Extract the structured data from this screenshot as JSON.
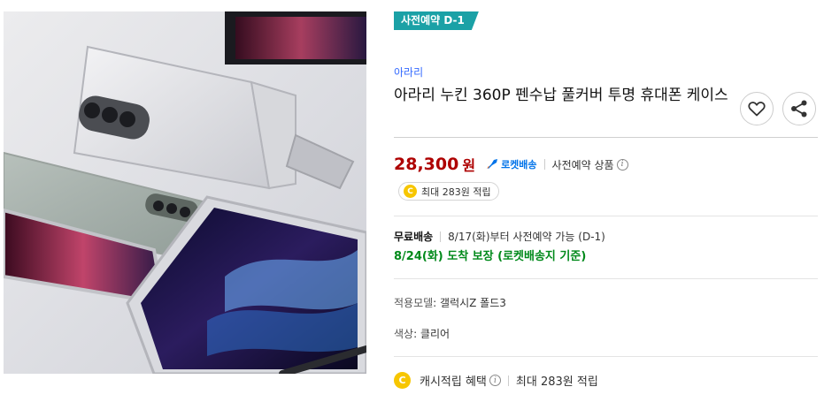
{
  "product": {
    "badge": "사전예약 D-1",
    "brand": "아라리",
    "title": "아라리 누킨 360P 펜수납 풀커버 투명 휴대폰 케이스",
    "price": "28,300",
    "price_unit": "원",
    "rocket_label": "로켓배송",
    "preorder_label": "사전예약 상품",
    "reward_text": "최대 283원 적립",
    "coin_letter": "C"
  },
  "shipping": {
    "label": "무료배송",
    "schedule": "8/17(화)부터 사전예약 가능 (D-1)",
    "arrival": "8/24(화) 도착 보장 (로켓배송지 기준)"
  },
  "specs": [
    {
      "label": "적용모델",
      "value": "갤럭시Z 폴드3"
    },
    {
      "label": "색상",
      "value": "클리어"
    }
  ],
  "cashback": {
    "label": "캐시적립 혜택",
    "value": "최대 283원 적립"
  },
  "icons": {
    "wish": "heart-icon",
    "share": "share-icon",
    "rocket": "rocket-icon",
    "info": "info-icon",
    "coin": "coin-icon"
  },
  "colors": {
    "badge": "#1ba1a6",
    "price": "#ae0000",
    "rocket": "#0073e9",
    "arrival": "#00891a",
    "brand": "#346aff",
    "coin": "#f7c600"
  }
}
